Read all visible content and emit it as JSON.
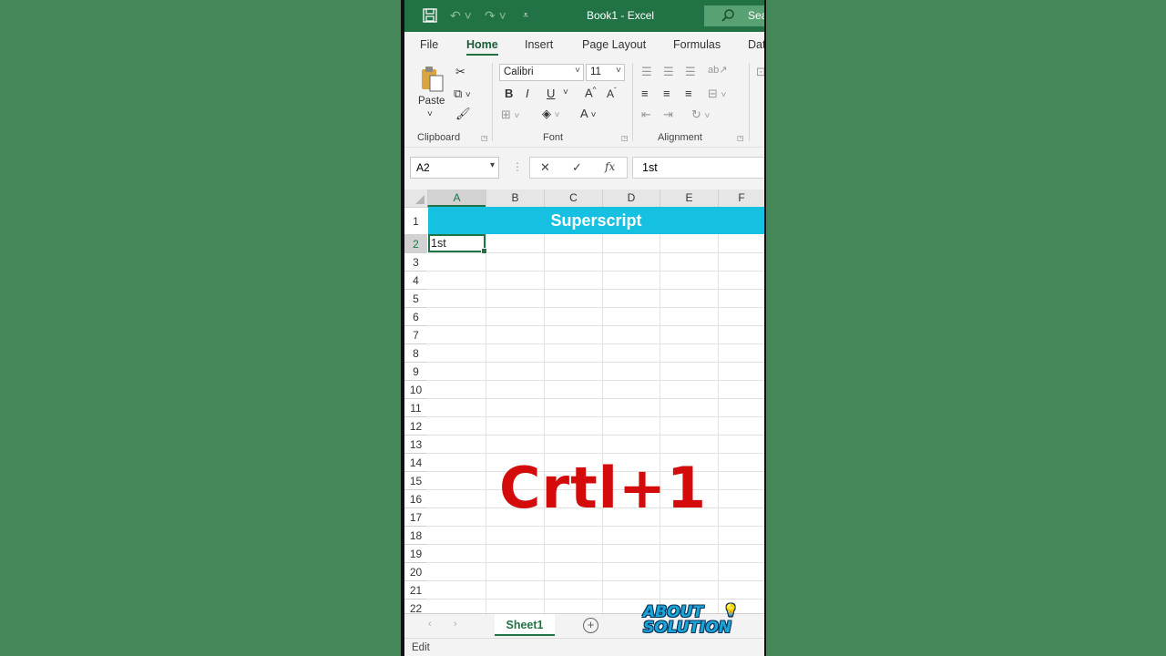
{
  "titlebar": {
    "title": "Book1  -  Excel",
    "search_label": "Sea"
  },
  "tabs": [
    "File",
    "Home",
    "Insert",
    "Page Layout",
    "Formulas",
    "Dat"
  ],
  "ribbon": {
    "clipboard": {
      "paste_label": "Paste",
      "group_label": "Clipboard"
    },
    "font": {
      "font_name": "Calibri",
      "font_size": "11",
      "group_label": "Font",
      "bold": "B",
      "italic": "I",
      "underline": "U"
    },
    "alignment": {
      "group_label": "Alignment"
    }
  },
  "formula_bar": {
    "name_box": "A2",
    "fx": "fx",
    "value": "1st"
  },
  "grid": {
    "columns": [
      "A",
      "B",
      "C",
      "D",
      "E",
      "F"
    ],
    "rows": [
      "1",
      "2",
      "3",
      "4",
      "5",
      "6",
      "7",
      "8",
      "9",
      "10",
      "11",
      "12",
      "13",
      "14",
      "15",
      "16",
      "17",
      "18",
      "19",
      "20",
      "21",
      "22"
    ],
    "banner_text": "Superscript",
    "a2_value": "1st",
    "selected_cell": "A2"
  },
  "overlay_text": "Crtl+1",
  "sheet_tabs": {
    "active": "Sheet1"
  },
  "logo": {
    "line1": "ABOUT",
    "line2": "SOLUTION"
  },
  "status": {
    "mode": "Edit"
  },
  "colors": {
    "excel_green": "#217346",
    "background": "#46875a",
    "banner": "#16c0e0",
    "overlay_red": "#d40b0b"
  }
}
